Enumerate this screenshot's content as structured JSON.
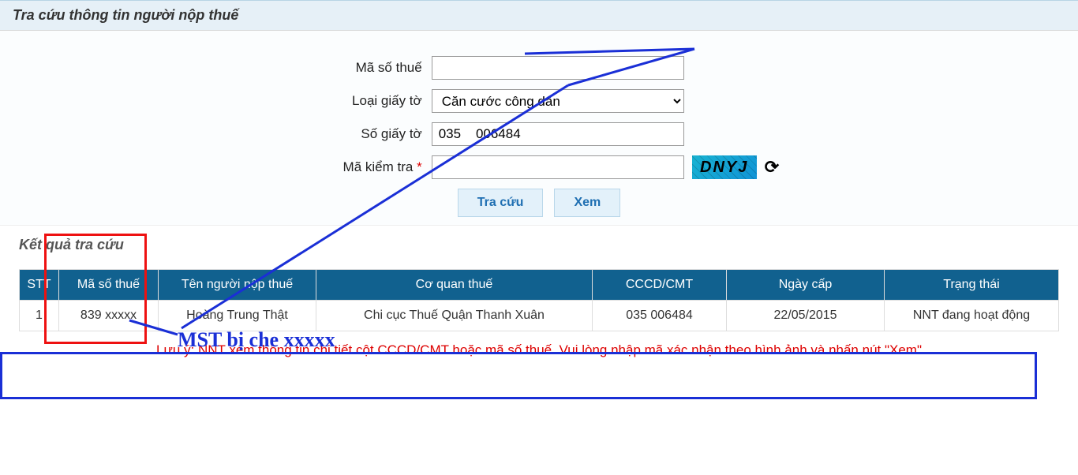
{
  "page": {
    "title": "Tra cứu thông tin người nộp thuế"
  },
  "form": {
    "label_mst": "Mã số thuế",
    "label_doc_type": "Loại giấy tờ",
    "label_doc_number": "Số giấy tờ",
    "label_captcha": "Mã kiểm tra",
    "value_mst": "",
    "value_doc_type": "Căn cước công dân",
    "doc_type_options": [
      "Căn cước công dân"
    ],
    "value_doc_number": "035    006484",
    "value_captcha": "",
    "captcha_text": "DNYJ",
    "btn_search": "Tra cứu",
    "btn_view": "Xem"
  },
  "results": {
    "title": "Kết quả tra cứu",
    "headers": [
      "STT",
      "Mã số thuế",
      "Tên người nộp thuế",
      "Cơ quan thuế",
      "CCCD/CMT",
      "Ngày cấp",
      "Trạng thái"
    ],
    "row": {
      "stt": "1",
      "mst": "839  xxxxx",
      "name": "Hoàng Trung Thật",
      "office": "Chi cục Thuế Quận Thanh Xuân",
      "cccd": "035     006484",
      "issued": "22/05/2015",
      "status": "NNT đang hoạt động"
    }
  },
  "annotations": {
    "mst_note": "MST bị che xxxxx"
  },
  "notice": "Lưu ý: NNT xem thông tin chi tiết cột CCCD/CMT hoặc mã số thuế. Vui lòng nhập mã xác nhận theo hình ảnh và nhấn nút \"Xem\""
}
